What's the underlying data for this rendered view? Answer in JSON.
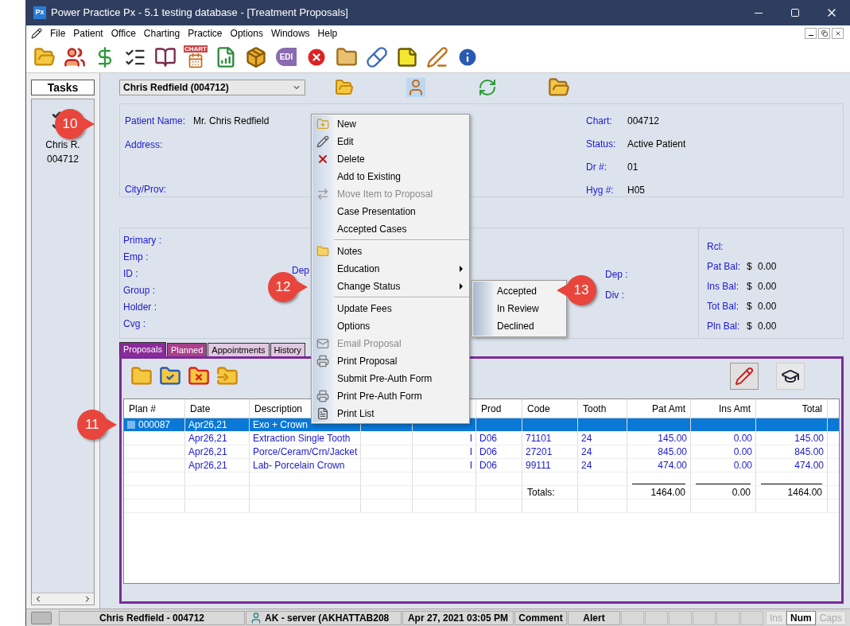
{
  "window": {
    "title": "Power Practice Px - 5.1 testing database - [Treatment Proposals]",
    "app_icon": "Px"
  },
  "menu": [
    "File",
    "Patient",
    "Office",
    "Charting",
    "Practice",
    "Options",
    "Windows",
    "Help"
  ],
  "toolbar": {
    "chart_icon_label": "CHART",
    "edi_icon_label": "EDI"
  },
  "tasks": {
    "title": "Tasks",
    "patient_name": "Chris R.",
    "patient_chart": "004712"
  },
  "patient_selector": {
    "value": "Chris Redfield (004712)"
  },
  "patient_info": {
    "left": [
      {
        "label": "Patient Name:",
        "value": "Mr. Chris Redfield"
      },
      {
        "label": "Address:"
      },
      {
        "label": "City/Prov:"
      }
    ],
    "right": [
      {
        "label": "Chart:",
        "value": "004712"
      },
      {
        "label": "Status:",
        "value": "Active Patient"
      },
      {
        "label": "Dr #:",
        "value": "01"
      },
      {
        "label": "Hyg #:",
        "value": "H05"
      }
    ]
  },
  "insurance": {
    "labels": [
      "Primary :",
      "Emp :",
      "ID :",
      "Group :",
      "Holder :",
      "Cvg :"
    ],
    "covered_label": "Dep",
    "right_labels": [
      "Dep :",
      "Div :"
    ]
  },
  "balances": [
    {
      "label": "Rcl:"
    },
    {
      "label": "Pat Bal:",
      "currency": "$",
      "amount": "0.00"
    },
    {
      "label": "Ins Bal:",
      "currency": "$",
      "amount": "0.00"
    },
    {
      "label": "Tot Bal:",
      "currency": "$",
      "amount": "0.00"
    },
    {
      "label": "Pln Bal:",
      "currency": "$",
      "amount": "0.00"
    }
  ],
  "tabs": [
    {
      "label": "Proposals",
      "selected": true
    },
    {
      "label": "Planned",
      "selected": false
    },
    {
      "label": "Appointments",
      "selected": false
    },
    {
      "label": "History",
      "selected": false
    }
  ],
  "table": {
    "columns": [
      "Plan #",
      "Date",
      "Description",
      "",
      "",
      "Prod",
      "Code",
      "Tooth",
      "Pat Amt",
      "Ins Amt",
      "Total"
    ],
    "rows": [
      {
        "selected": true,
        "cells": [
          "000087",
          "Apr26,21",
          "Exo + Crown",
          "",
          "",
          "",
          "",
          "",
          "",
          "",
          ""
        ]
      },
      {
        "selected": false,
        "cells": [
          "",
          "Apr26,21",
          "Extraction Single Tooth",
          "",
          "I",
          "D06",
          "71101",
          "24",
          "145.00",
          "0.00",
          "145.00"
        ]
      },
      {
        "selected": false,
        "cells": [
          "",
          "Apr26,21",
          "Porce/Ceram/Crn/Jacket",
          "",
          "I",
          "D06",
          "27201",
          "24",
          "845.00",
          "0.00",
          "845.00"
        ]
      },
      {
        "selected": false,
        "cells": [
          "",
          "Apr26,21",
          "Lab- Porcelain Crown",
          "",
          "I",
          "D06",
          "99111",
          "24",
          "474.00",
          "0.00",
          "474.00"
        ]
      }
    ],
    "totals_label": "Totals:",
    "totals": [
      "1464.00",
      "0.00",
      "1464.00"
    ]
  },
  "context_menu": [
    {
      "kind": "item",
      "text": "New",
      "disabled": false,
      "submenu": false
    },
    {
      "kind": "item",
      "text": "Edit",
      "disabled": false,
      "submenu": false
    },
    {
      "kind": "item",
      "text": "Delete",
      "disabled": false,
      "submenu": false
    },
    {
      "kind": "item",
      "text": "Add to Existing",
      "disabled": false,
      "submenu": false
    },
    {
      "kind": "item",
      "text": "Move Item to Proposal",
      "disabled": true,
      "submenu": false
    },
    {
      "kind": "item",
      "text": "Case Presentation",
      "disabled": false,
      "submenu": false
    },
    {
      "kind": "item",
      "text": "Accepted Cases",
      "disabled": false,
      "submenu": false
    },
    {
      "kind": "separator"
    },
    {
      "kind": "item",
      "text": "Notes",
      "disabled": false,
      "submenu": false
    },
    {
      "kind": "item",
      "text": "Education",
      "disabled": false,
      "submenu": true
    },
    {
      "kind": "item",
      "text": "Change Status",
      "disabled": false,
      "submenu": true
    },
    {
      "kind": "separator"
    },
    {
      "kind": "item",
      "text": "Update Fees",
      "disabled": false,
      "submenu": false
    },
    {
      "kind": "item",
      "text": "Options",
      "disabled": false,
      "submenu": false
    },
    {
      "kind": "item",
      "text": "Email Proposal",
      "disabled": true,
      "submenu": false
    },
    {
      "kind": "item",
      "text": "Print Proposal",
      "disabled": false,
      "submenu": false
    },
    {
      "kind": "item",
      "text": "Submit Pre-Auth Form",
      "disabled": false,
      "submenu": false
    },
    {
      "kind": "item",
      "text": "Print Pre-Auth Form",
      "disabled": false,
      "submenu": false
    },
    {
      "kind": "item",
      "text": "Print List",
      "disabled": false,
      "submenu": false
    }
  ],
  "submenu": [
    "Accepted",
    "In Review",
    "Declined"
  ],
  "status_bar": {
    "cells": [
      "Chris Redfield - 004712",
      "AK - server (AKHATTAB208",
      "Apr 27, 2021 03:05 PM",
      "Comment",
      "Alert"
    ],
    "indicators": [
      {
        "text": "Ins",
        "on": false
      },
      {
        "text": "Num",
        "on": true
      },
      {
        "text": "Caps",
        "on": false
      }
    ]
  },
  "callouts": [
    "10",
    "11",
    "12",
    "13"
  ]
}
